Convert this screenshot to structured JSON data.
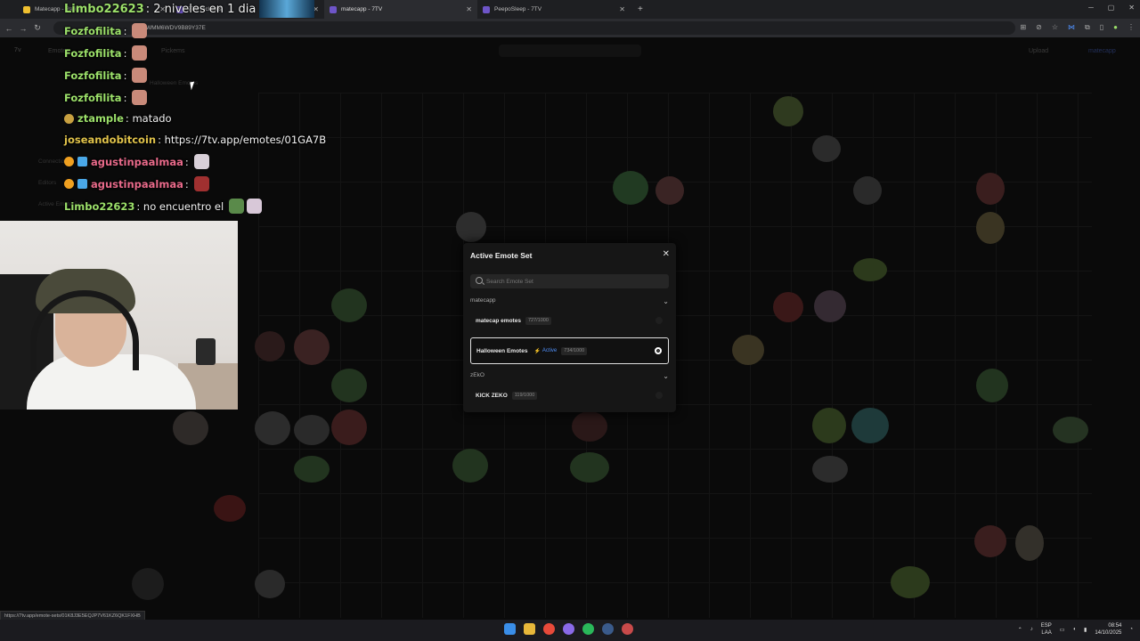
{
  "browser": {
    "tabs": [
      {
        "label": "Matecapp - Rarity"
      },
      {
        "label": "7TV Pickems"
      },
      {
        "label": "matecapp - 7TV",
        "active": true
      },
      {
        "label": "PeepoSleep - 7TV"
      }
    ],
    "url": "FWMM6WDV9B89Y37E",
    "status_url": "https://7tv.app/emote-sets/01K8J3E5EQJP7V61KZ6QK1FXHB"
  },
  "site": {
    "nav": {
      "emotes": "Emotes",
      "pickems": "Pickems",
      "upload": "Upload",
      "user": "matecapp"
    },
    "menu": {
      "halloween": "Halloween Emotes",
      "editors": "Editors",
      "connections": "Connections",
      "active": "Active Emote Set"
    }
  },
  "chat": [
    {
      "user": "Limbo22623",
      "color": "#9ce06a",
      "text": ": 2 niveles en 1 dia"
    },
    {
      "user": "Fozfofilita",
      "color": "#9ce06a",
      "text": ":"
    },
    {
      "user": "Fozfofilita",
      "color": "#9ce06a",
      "text": ":"
    },
    {
      "user": "Fozfofilita",
      "color": "#9ce06a",
      "text": ":"
    },
    {
      "user": "Fozfofilita",
      "color": "#9ce06a",
      "text": ":"
    },
    {
      "user": "ztample",
      "color": "#9ce06a",
      "text": ": matado"
    },
    {
      "user": "joseandobitcoin",
      "color": "#e0c24a",
      "text": ": https://7tv.app/emotes/01GA7B"
    },
    {
      "user": "agustinpaalmaa",
      "color": "#e86a8a",
      "text": ":"
    },
    {
      "user": "agustinpaalmaa",
      "color": "#e86a8a",
      "text": ":"
    },
    {
      "user": "Limbo22623",
      "color": "#9ce06a",
      "text": ": no encuentro el"
    }
  ],
  "modal": {
    "title": "Active Emote Set",
    "search_placeholder": "Search Emote Set",
    "groups": [
      {
        "owner": "matecapp",
        "sets": [
          {
            "name": "matecap emotes",
            "count": "727/1000",
            "active": false
          },
          {
            "name": "Halloween Emotes",
            "count": "734/1000",
            "active": true,
            "active_label": "Active"
          }
        ]
      },
      {
        "owner": "zEkO",
        "sets": [
          {
            "name": "KICK ZEKO",
            "count": "119/1000",
            "active": false
          }
        ]
      }
    ]
  },
  "taskbar": {
    "lang": "ESP",
    "lang2": "LAA",
    "time": "08:54",
    "date": "14/10/2025"
  },
  "colors": {
    "accent": "#4f8ef7",
    "chat_green": "#9ce06a"
  }
}
